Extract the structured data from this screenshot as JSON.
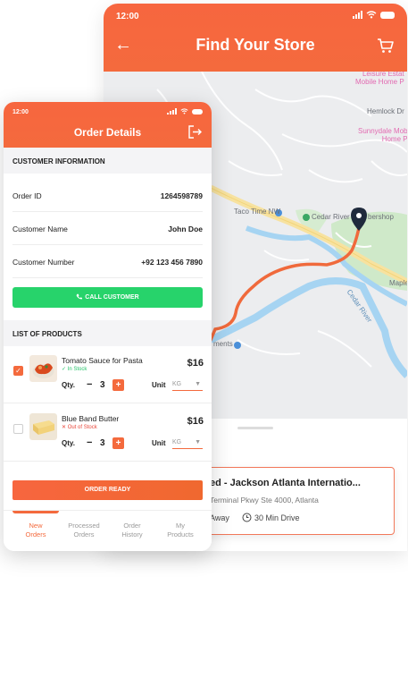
{
  "store_screen": {
    "status_time": "12:00",
    "title": "Find Your Store",
    "map_labels": {
      "leisure": "Leisure Estat\nMobile Home P",
      "hemlock": "Hemlock Dr",
      "sunnydale": "Sunnydale Mob\nHome P",
      "taco": "Taco Time NW",
      "cedar": "Cedar River",
      "bershop": "bershop",
      "maple": "Maple",
      "ments": "ments",
      "cedar_river": "Cedar River"
    },
    "sheet_fragment": "s",
    "store_name": "ed - Jackson Atlanta Internatio...",
    "store_address": "Terminal Pkwy Ste 4000, Atlanta",
    "store_away": "Away",
    "store_drive": "30 Min Drive"
  },
  "order_screen": {
    "status_time": "12:00",
    "title": "Order Details",
    "customer_section": "CUSTOMER INFORMATION",
    "fields": [
      {
        "label": "Order ID",
        "value": "1264598789"
      },
      {
        "label": "Customer Name",
        "value": "John Doe"
      },
      {
        "label": "Customer Number",
        "value": "+92 123 456 7890"
      }
    ],
    "call_label": "CALL CUSTOMER",
    "products_section": "LIST OF PRODUCTS",
    "products": [
      {
        "name": "Tomato Sauce for Pasta",
        "stock": "In Stock",
        "price": "$16",
        "qty_label": "Qty.",
        "qty": "3",
        "unit_label": "Unit",
        "unit": "KG",
        "checked": true
      },
      {
        "name": "Blue Band Butter",
        "stock": "Out of Stock",
        "price": "$16",
        "qty_label": "Qty.",
        "qty": "3",
        "unit_label": "Unit",
        "unit": "KG",
        "checked": false
      }
    ],
    "order_ready_label": "ORDER READY",
    "nav": [
      {
        "label": "New\nOrders",
        "active": true
      },
      {
        "label": "Processed\nOrders",
        "active": false
      },
      {
        "label": "Order\nHistory",
        "active": false
      },
      {
        "label": "My\nProducts",
        "active": false
      }
    ]
  },
  "colors": {
    "accent": "#f46a3d",
    "call_green": "#27d36b",
    "in_stock": "#27c46b",
    "out_of_stock": "#e8473a"
  }
}
